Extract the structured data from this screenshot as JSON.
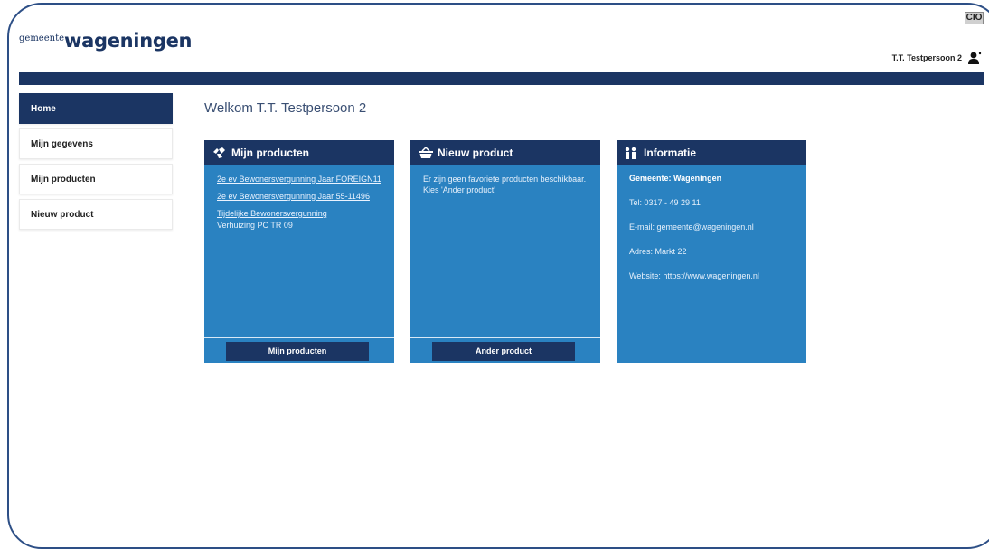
{
  "logo": {
    "small": "gemeente",
    "big": "wageningen"
  },
  "toggle_label": "CIO",
  "user": {
    "name": "T.T. Testpersoon 2",
    "icon": "user-icon"
  },
  "sidebar": {
    "items": [
      {
        "label": "Home",
        "active": true
      },
      {
        "label": "Mijn gegevens"
      },
      {
        "label": "Mijn producten"
      },
      {
        "label": "Nieuw product"
      }
    ]
  },
  "welcome": "Welkom T.T. Testpersoon 2",
  "cards": {
    "producten": {
      "title": "Mijn producten",
      "icon": "hands-icon",
      "links": [
        "2e ev Bewonersvergunning Jaar FOREIGN11",
        "2e ev Bewonersvergunning Jaar 55-11496",
        "Tijdelijke Bewonersvergunning"
      ],
      "text": "Verhuizing PC TR 09",
      "button": "Mijn producten"
    },
    "nieuw": {
      "title": "Nieuw product",
      "icon": "basket-icon",
      "text": "Er zijn geen favoriete producten beschikbaar. Kies 'Ander product'",
      "button": "Ander product"
    },
    "informatie": {
      "title": "Informatie",
      "icon": "people-info-icon",
      "gemeente": "Gemeente: Wageningen",
      "tel": "Tel: 0317 - 49 29 11",
      "email": "E-mail: gemeente@wageningen.nl",
      "adres": "Adres: Markt 22",
      "website": "Website: https://www.wageningen.nl"
    }
  },
  "colors": {
    "navy": "#1b3563",
    "card_blue": "#2a82c1"
  }
}
